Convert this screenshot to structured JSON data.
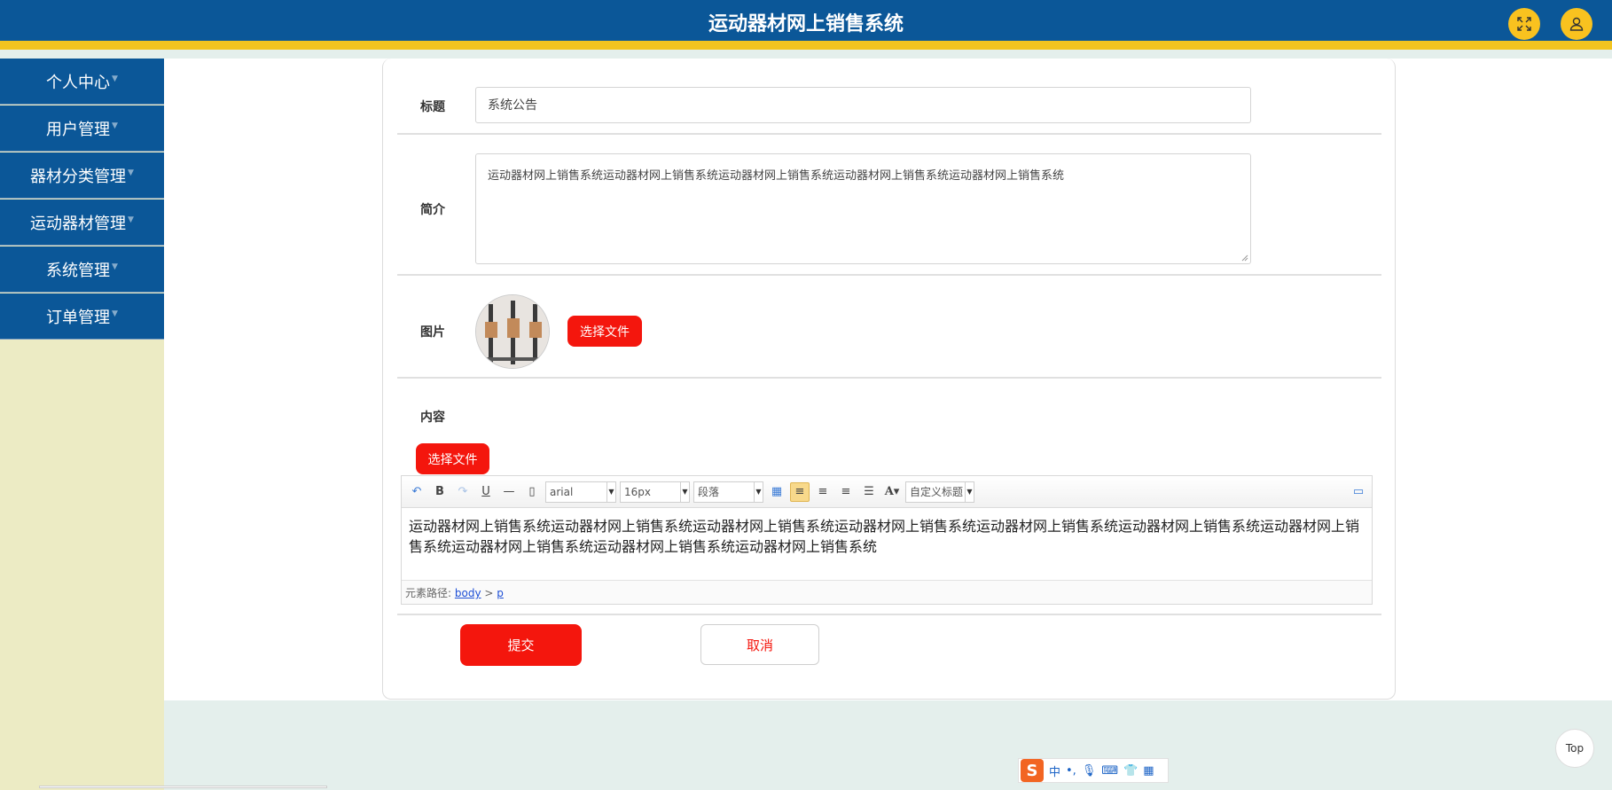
{
  "header": {
    "title": "运动器材网上销售系统",
    "fullscreen_icon": "expand-icon",
    "user_icon": "user-icon"
  },
  "sidebar": {
    "items": [
      {
        "label": "个人中心"
      },
      {
        "label": "用户管理"
      },
      {
        "label": "器材分类管理"
      },
      {
        "label": "运动器材管理"
      },
      {
        "label": "系统管理"
      },
      {
        "label": "订单管理"
      }
    ]
  },
  "form": {
    "title_label": "标题",
    "title_value": "系统公告",
    "intro_label": "简介",
    "intro_value": "运动器材网上销售系统运动器材网上销售系统运动器材网上销售系统运动器材网上销售系统运动器材网上销售系统",
    "image_label": "图片",
    "image_button": "选择文件",
    "content_label": "内容",
    "content_button": "选择文件",
    "submit_label": "提交",
    "cancel_label": "取消"
  },
  "editor": {
    "font_family": "arial",
    "font_size": "16px",
    "paragraph": "段落",
    "custom_title": "自定义标题",
    "content": "运动器材网上销售系统运动器材网上销售系统运动器材网上销售系统运动器材网上销售系统运动器材网上销售系统运动器材网上销售系统运动器材网上销售系统运动器材网上销售系统运动器材网上销售系统运动器材网上销售系统",
    "path_label": "元素路径:",
    "path_body": "body",
    "path_sep": ">",
    "path_p": "p"
  },
  "misc": {
    "top_label": "Top",
    "ime_lang": "中"
  }
}
